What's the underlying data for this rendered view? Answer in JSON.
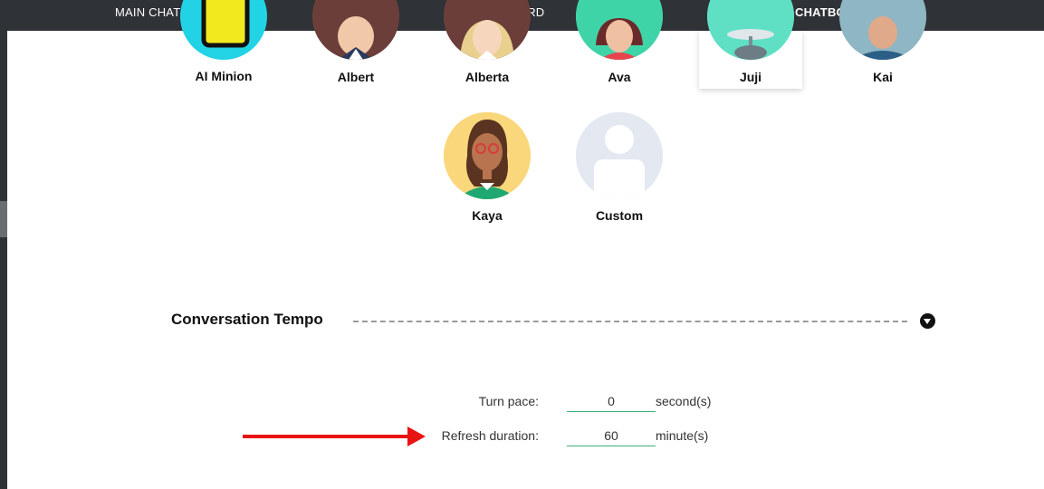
{
  "nav": {
    "tabs": [
      {
        "label": "MAIN CHAT FLOW"
      },
      {
        "label": "Q&A BOARD"
      },
      {
        "label": "CHATBOT SETTINGS"
      }
    ],
    "active": "CHATBOT SETTINGS"
  },
  "avatars": {
    "row1": [
      {
        "name": "AI Minion"
      },
      {
        "name": "Albert"
      },
      {
        "name": "Alberta"
      },
      {
        "name": "Ava"
      },
      {
        "name": "Juji"
      },
      {
        "name": "Kai"
      }
    ],
    "row2": [
      {
        "name": "Kaya"
      },
      {
        "name": "Custom"
      }
    ],
    "selected": "Juji"
  },
  "tempo": {
    "title": "Conversation Tempo",
    "turn_pace": {
      "label": "Turn pace:",
      "value": "0",
      "unit": "second(s)"
    },
    "refresh": {
      "label": "Refresh duration:",
      "value": "60",
      "unit": "minute(s)"
    }
  },
  "colors": {
    "topbar": "#2f3237",
    "input_underline": "#3bb07b",
    "annotation_arrow": "#e81414"
  }
}
